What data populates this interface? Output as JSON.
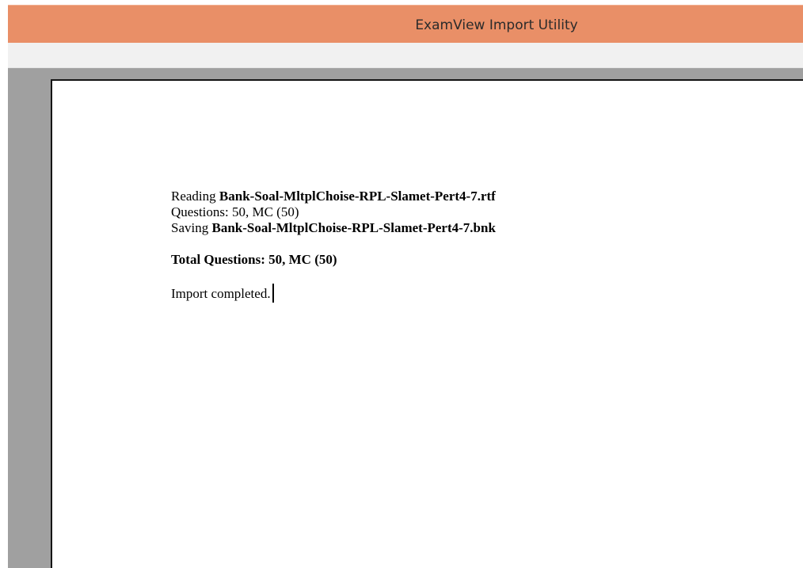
{
  "window": {
    "title": "ExamView Import Utility"
  },
  "colors": {
    "titlebar": "#e98f67",
    "workspace": "#a0a0a0",
    "page": "#ffffff"
  },
  "log": {
    "reading_prefix": "Reading",
    "reading_file": "Bank-Soal-MltplChoise-RPL-Slamet-Pert4-7.rtf",
    "questions_line": "Questions: 50, MC (50)",
    "saving_prefix": "Saving",
    "saving_file": "Bank-Soal-MltplChoise-RPL-Slamet-Pert4-7.bnk",
    "total_line": "Total Questions: 50, MC (50)",
    "status_line": "Import completed."
  }
}
